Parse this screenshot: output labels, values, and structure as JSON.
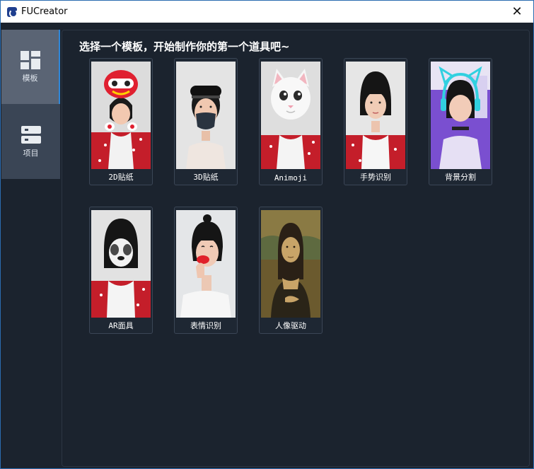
{
  "window": {
    "title": "FUCreator",
    "close_glyph": "✕"
  },
  "sidebar": {
    "items": [
      {
        "label": "模板",
        "icon": "template-grid-icon",
        "active": true
      },
      {
        "label": "项目",
        "icon": "project-icon",
        "active": false
      }
    ]
  },
  "main": {
    "heading": "选择一个模板，开始制作你的第一个道具吧~",
    "templates": [
      {
        "label": "2D贴纸",
        "image": "girl with red lion-dance mask sticker"
      },
      {
        "label": "3D贴纸",
        "image": "girl wearing black face mask and black cap"
      },
      {
        "label": "Animoji",
        "image": "girl with white cat animoji head"
      },
      {
        "label": "手势识别",
        "image": "girl with bob haircut, white top"
      },
      {
        "label": "背景分割",
        "image": "girl with cat-ear headphones on purple background"
      },
      {
        "label": "AR面具",
        "image": "girl with panda face mask"
      },
      {
        "label": "表情识别",
        "image": "girl with red lips blowing kiss"
      },
      {
        "label": "人像驱动",
        "image": "mona lisa painting"
      }
    ]
  },
  "colors": {
    "background": "#1b232e",
    "sidebar": "#3a4555",
    "sidebar_active": "#5a6474",
    "accent": "#2f87d8",
    "card_border": "#3b4656"
  }
}
